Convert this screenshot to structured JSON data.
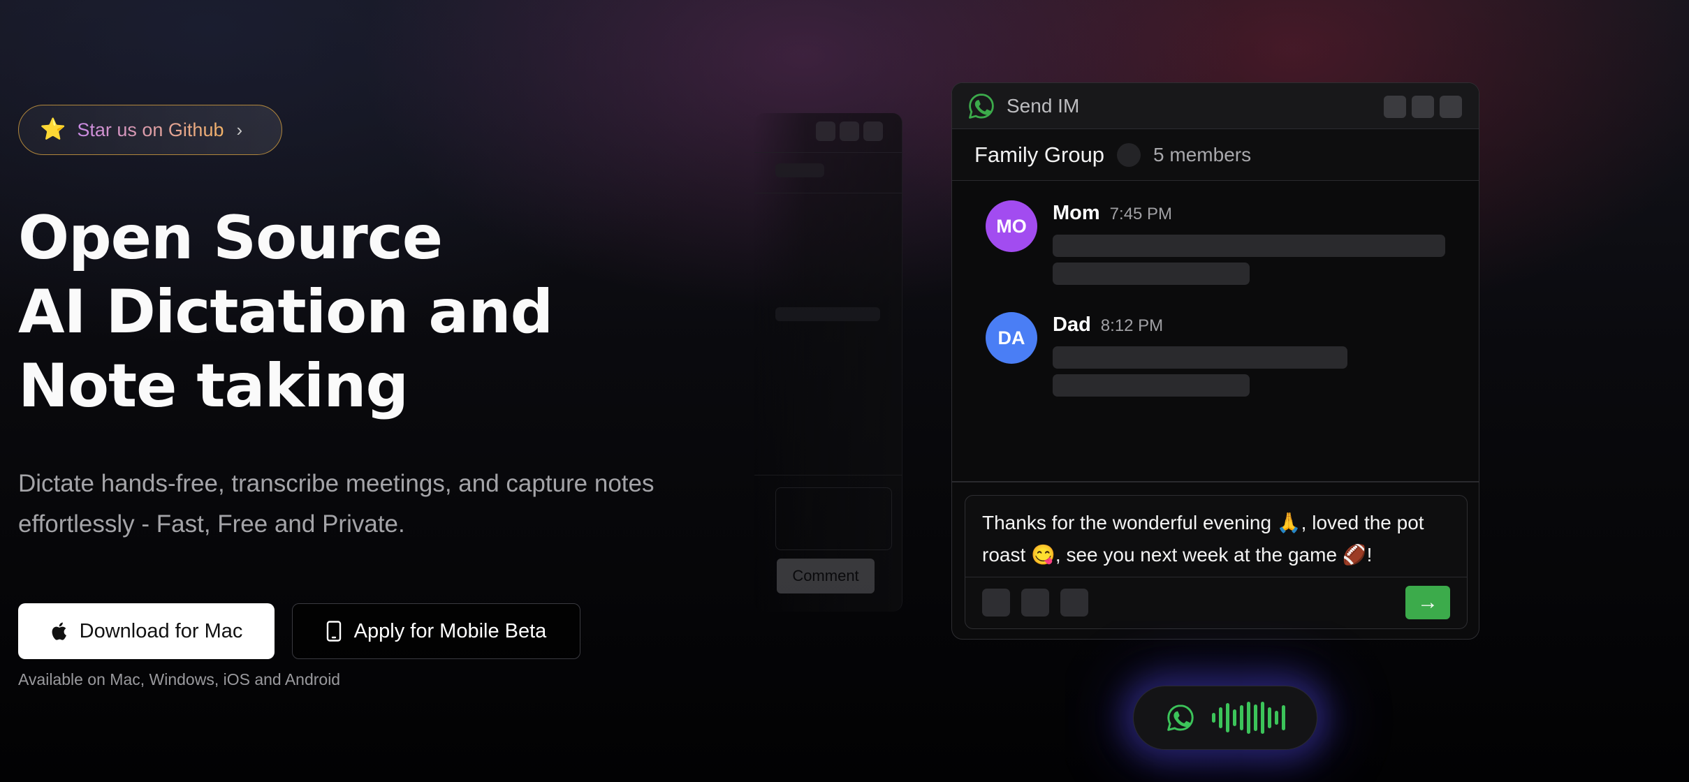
{
  "github_pill": {
    "star": "⭐",
    "label": "Star us on Github",
    "chevron": "›"
  },
  "hero": {
    "title_lines": [
      "Open Source",
      "AI Dictation and",
      "Note taking"
    ],
    "subtitle": "Dictate hands-free, transcribe meetings, and capture notes effortlessly - Fast, Free and Private."
  },
  "cta": {
    "mac_label": "Download for Mac",
    "mobile_label": "Apply for Mobile Beta",
    "availability": "Available on Mac, Windows, iOS and Android"
  },
  "ghost_window": {
    "comment_label": "Comment"
  },
  "chat_window": {
    "title": "Send IM",
    "app_icon": "whatsapp-icon",
    "group": {
      "name": "Family Group",
      "members": "5 members"
    },
    "messages": [
      {
        "initials": "MO",
        "name": "Mom",
        "time": "7:45 PM",
        "avatar_color": "#a24cf0"
      },
      {
        "initials": "DA",
        "name": "Dad",
        "time": "8:12 PM",
        "avatar_color": "#4a7ef5"
      }
    ],
    "composer": {
      "line1": "Thanks for the wonderful evening 🙏, loved the pot",
      "line2": "roast 😋, see you next week at the game 🏈!",
      "send_label": "→"
    }
  },
  "voice_pill": {
    "icon": "whatsapp-icon",
    "accent": "#3cc45a"
  },
  "colors": {
    "whatsapp_green": "#3cab4b",
    "github_border": "#b0863c",
    "voice_glow": "#5a50ff"
  }
}
